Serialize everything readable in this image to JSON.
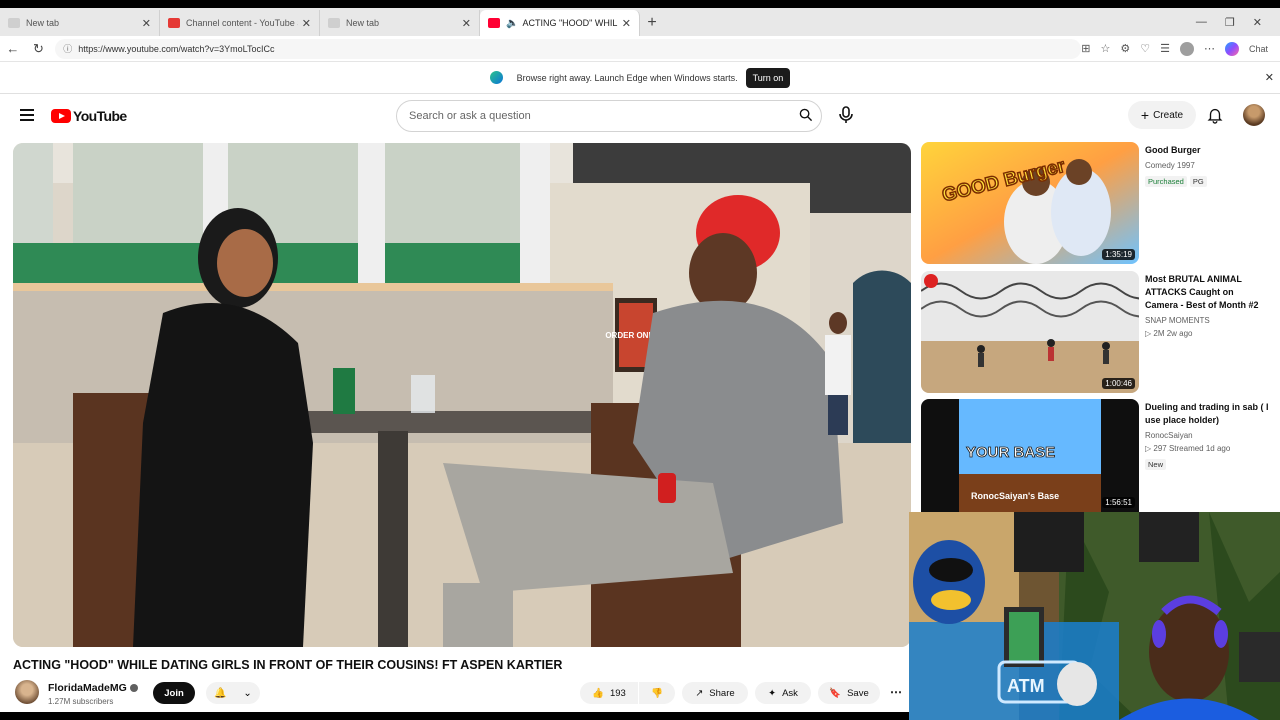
{
  "browser": {
    "tabs": [
      {
        "label": "New tab",
        "type": "blank",
        "active": false
      },
      {
        "label": "Channel content - YouTube Studio",
        "type": "studio",
        "active": false
      },
      {
        "label": "New tab",
        "type": "blank",
        "active": false
      },
      {
        "label": "ACTING \"HOOD\" WHILE DATIN",
        "type": "yt",
        "active": true
      }
    ],
    "url": "https://www.youtube.com/watch?v=3YmoLTocICc",
    "chat_label": "Chat",
    "infobar": {
      "text": "Browse right away. Launch Edge when Windows starts.",
      "button": "Turn on"
    }
  },
  "header": {
    "logo_text": "YouTube",
    "search_placeholder": "Search or ask a question",
    "create_label": "Create"
  },
  "video": {
    "title": "ACTING \"HOOD\" WHILE DATING GIRLS IN FRONT OF THEIR COUSINS! FT ASPEN KARTIER",
    "scene_sign": "ORDER ONLINE",
    "channel": {
      "name": "FloridaMadeMG",
      "subs": "1.27M subscribers",
      "join": "Join"
    },
    "actions": {
      "likes": "193",
      "share": "Share",
      "ask": "Ask",
      "save": "Save"
    }
  },
  "recommendations": [
    {
      "title": "Good Burger",
      "meta1": "Comedy 1997",
      "badges": [
        "Purchased",
        "PG"
      ],
      "duration": "1:35:19",
      "thumb_text": "GOOD Burger"
    },
    {
      "title": "Most BRUTAL ANIMAL ATTACKS Caught on Camera - Best of Month #2",
      "meta1": "SNAP MOMENTS",
      "meta2": "▷ 2M  2w ago",
      "badges": [],
      "duration": "1:00:46"
    },
    {
      "title": "Dueling and trading in sab ( I use place holder)",
      "meta1": "RonocSaiyan",
      "meta2": "▷ 297  Streamed 1d ago",
      "badges": [
        "New"
      ],
      "duration": "1:56:51",
      "thumb_text": "YOUR BASE",
      "thumb_sub": "RonocSaiyan's Base"
    }
  ],
  "webcam": {
    "sign_text": "ATM"
  }
}
